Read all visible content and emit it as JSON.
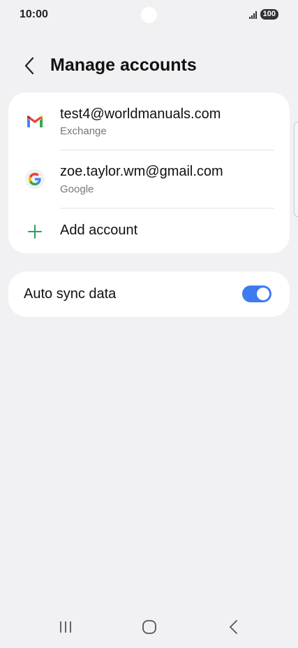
{
  "status_bar": {
    "time": "10:00",
    "battery": "100"
  },
  "header": {
    "title": "Manage accounts"
  },
  "accounts": [
    {
      "title": "test4@worldmanuals.com",
      "subtitle": "Exchange",
      "icon": "gmail-icon"
    },
    {
      "title": "zoe.taylor.wm@gmail.com",
      "subtitle": "Google",
      "icon": "google-icon"
    }
  ],
  "add_account": {
    "label": "Add account",
    "icon": "plus-icon"
  },
  "auto_sync": {
    "label": "Auto sync data",
    "enabled": true
  },
  "colors": {
    "accent": "#3e7bf1",
    "add_icon": "#2e9d6a",
    "background": "#f1f1f3"
  },
  "nav": {
    "icons": [
      "recents-icon",
      "home-icon",
      "back-icon"
    ]
  }
}
